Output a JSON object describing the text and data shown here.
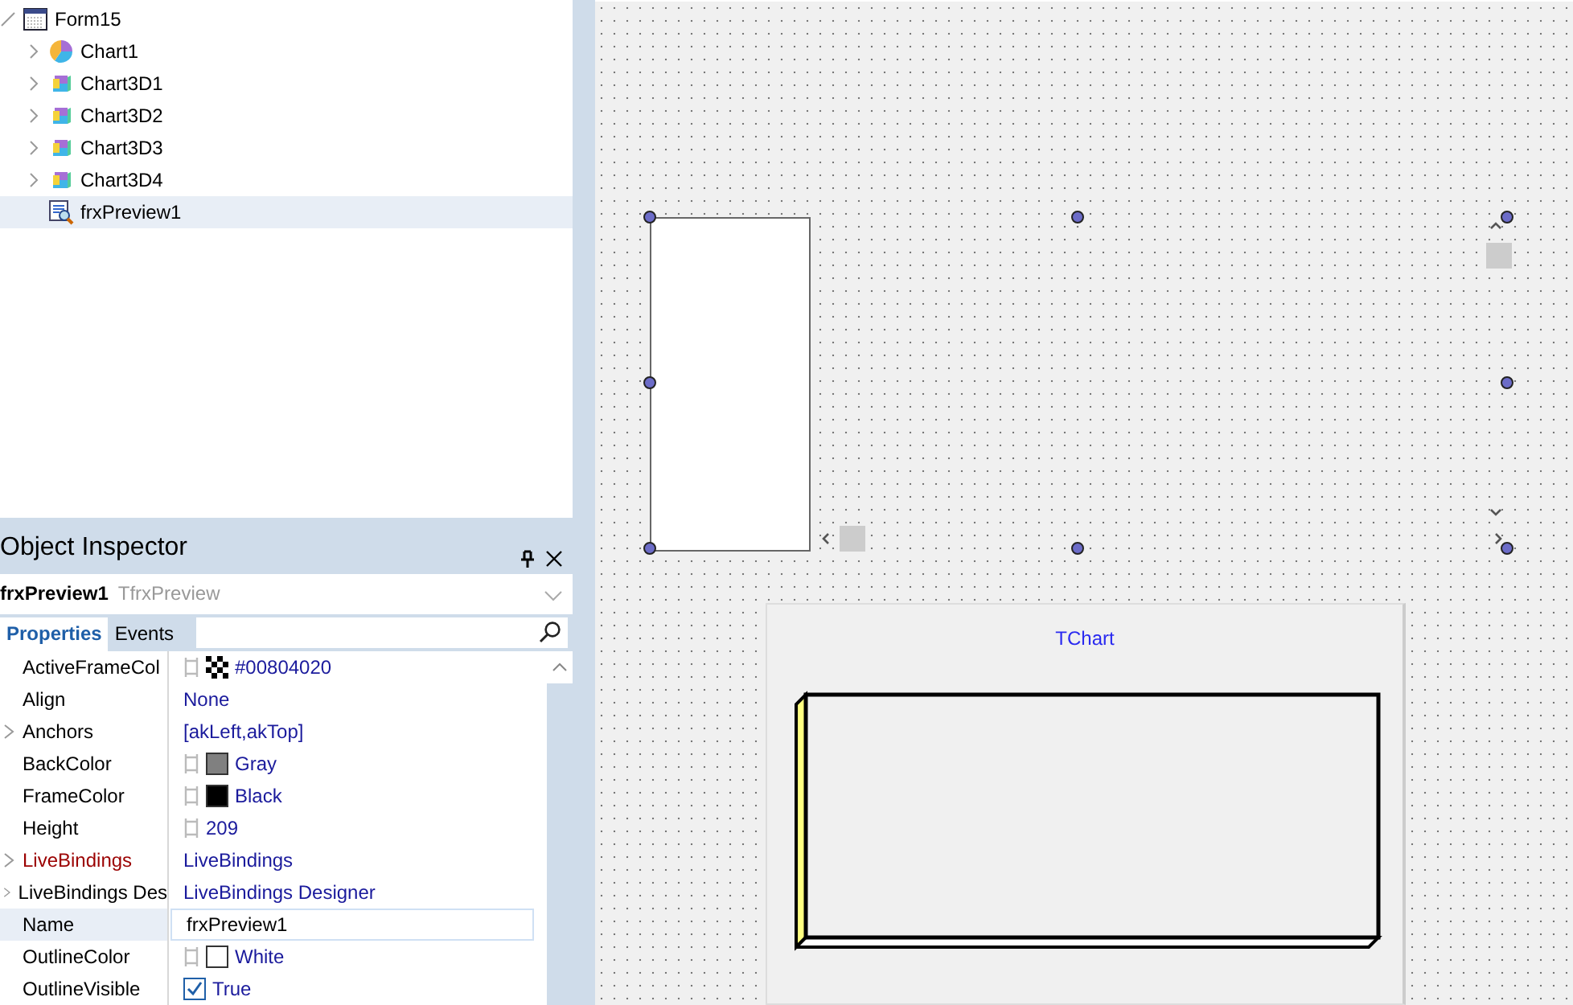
{
  "structure": {
    "items": [
      {
        "label": "Form15",
        "kind": "form",
        "expanded": true,
        "selected": false,
        "children": [
          {
            "label": "Chart1",
            "kind": "pie",
            "expanded": false,
            "selected": false
          },
          {
            "label": "Chart3D1",
            "kind": "chart3d",
            "expanded": false,
            "selected": false
          },
          {
            "label": "Chart3D2",
            "kind": "chart3d",
            "expanded": false,
            "selected": false
          },
          {
            "label": "Chart3D3",
            "kind": "chart3d",
            "expanded": false,
            "selected": false
          },
          {
            "label": "Chart3D4",
            "kind": "chart3d",
            "expanded": false,
            "selected": false
          },
          {
            "label": "frxPreview1",
            "kind": "preview",
            "selected": true
          }
        ]
      }
    ]
  },
  "inspector": {
    "title": "Object Inspector",
    "object_name": "frxPreview1",
    "object_type": "TfrxPreview",
    "tabs": [
      {
        "label": "Properties",
        "selected": true
      },
      {
        "label": "Events",
        "selected": false
      }
    ],
    "properties": [
      {
        "name": "ActiveFrameCol",
        "value": "#00804020",
        "kind": "checker",
        "is_binding": false,
        "selected": false
      },
      {
        "name": "Align",
        "value": "None",
        "kind": "text",
        "is_binding": false,
        "selected": false
      },
      {
        "name": "Anchors",
        "value": "[akLeft,akTop]",
        "kind": "text",
        "expanded": false,
        "is_binding": false,
        "selected": false
      },
      {
        "name": "BackColor",
        "value": "Gray",
        "kind": "color",
        "color": "#808080",
        "is_binding": false,
        "selected": false
      },
      {
        "name": "FrameColor",
        "value": "Black",
        "kind": "color",
        "color": "#000000",
        "is_binding": false,
        "selected": false
      },
      {
        "name": "Height",
        "value": "209",
        "kind": "number",
        "is_binding": false,
        "selected": false
      },
      {
        "name": "LiveBindings",
        "value": "LiveBindings",
        "kind": "text",
        "expanded": false,
        "is_binding": true,
        "selected": false
      },
      {
        "name": "LiveBindings Des",
        "value": "LiveBindings Designer",
        "kind": "text",
        "expanded": false,
        "is_binding": false,
        "selected": false
      },
      {
        "name": "Name",
        "value": "frxPreview1",
        "kind": "edit",
        "is_binding": false,
        "selected": true
      },
      {
        "name": "OutlineColor",
        "value": "White",
        "kind": "color",
        "color": "#ffffff",
        "is_binding": false,
        "selected": false
      },
      {
        "name": "OutlineVisible",
        "value": "True",
        "kind": "bool",
        "checked": true,
        "is_binding": false,
        "selected": false
      }
    ]
  },
  "designer": {
    "chart": {
      "title": "TChart"
    }
  }
}
